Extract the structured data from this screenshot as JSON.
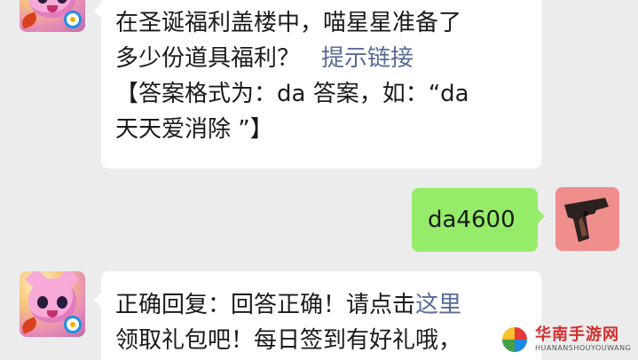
{
  "colors": {
    "chat_background": "#ececec",
    "incoming_bubble": "#ffffff",
    "outgoing_bubble": "#95ec69",
    "link": "#576b95"
  },
  "messages": [
    {
      "sender": "game-account",
      "avatar_icon": "cat-game-avatar-icon",
      "lines": [
        "在圣诞福利盖楼中，喵星星准备了",
        "多少份道具福利？"
      ],
      "link_text": "提示链接",
      "extra_lines": [
        "【答案格式为：da 答案，如：“da",
        "天天爱消除 ”】"
      ]
    },
    {
      "sender": "me",
      "avatar_icon": "gun-avatar-icon",
      "text": "da4600"
    },
    {
      "sender": "game-account",
      "avatar_icon": "cat-game-avatar-icon",
      "prefix": "正确回复：回答正确！请点击",
      "link_text": "这里",
      "line2": "领取礼包吧！每日签到有好礼哦，"
    }
  ],
  "watermark": {
    "title": "华南手游网",
    "subtitle": "HUANANSHOUYOUWANG"
  }
}
